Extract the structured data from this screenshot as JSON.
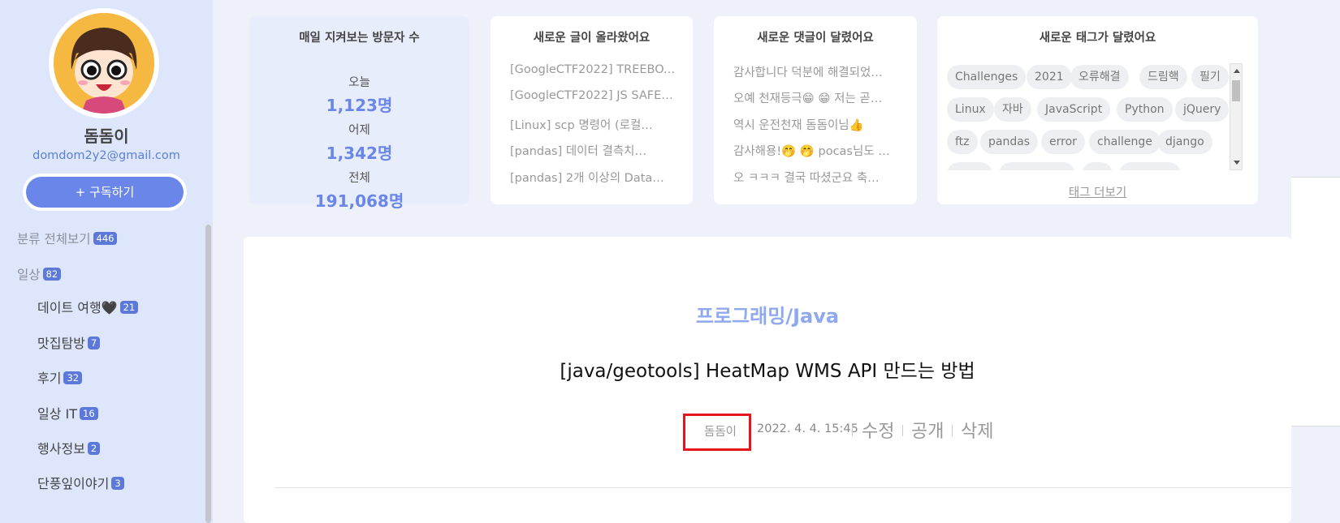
{
  "profile": {
    "name": "돔돔이",
    "email": "domdom2y2@gmail.com",
    "subscribe_label": "+ 구독하기"
  },
  "categories": [
    {
      "label": "분류 전체보기",
      "count": "446"
    },
    {
      "label": "일상",
      "count": "82"
    },
    {
      "label": "데이트 여행🖤",
      "count": "21"
    },
    {
      "label": "맛집탐방",
      "count": "7"
    },
    {
      "label": "후기",
      "count": "32"
    },
    {
      "label": "일상 IT",
      "count": "16"
    },
    {
      "label": "행사정보",
      "count": "2"
    },
    {
      "label": "단풍잎이야기",
      "count": "3"
    }
  ],
  "visitors": {
    "title": "매일 지켜보는 방문자 수",
    "today_label": "오늘",
    "today_value": "1,123명",
    "yesterday_label": "어제",
    "yesterday_value": "1,342명",
    "total_label": "전체",
    "total_value": "191,068명"
  },
  "new_posts": {
    "title": "새로운 글이 올라왔어요",
    "items": [
      "[GoogleCTF2022] TREEBOX…",
      "[GoogleCTF2022] JS SAFE…",
      "[Linux] scp 명령어 (로컬…",
      "[pandas] 데이터 결측치…",
      "[pandas] 2개 이상의 Data…"
    ]
  },
  "new_comments": {
    "title": "새로운 댓글이 달렸어요",
    "items": [
      "감사합니다 덕분에 해결되었…",
      "오예 천재등극😁 😁 저는 곧…",
      "역시 운전천재 돔돔이님👍",
      "감사해용!🤭 🤭 pocas님도 운…",
      "오 ㅋㅋㅋ 결국 따셨군요 축…"
    ]
  },
  "new_tags": {
    "title": "새로운 태그가 달렸어요",
    "tags": [
      "Challenges",
      "2021",
      "오류해결",
      "드림핵",
      "필기",
      "Linux",
      "자바",
      "JavaScript",
      "Python",
      "jQuery",
      "ftz",
      "pandas",
      "error",
      "challenge",
      "django"
    ],
    "more_label": "태그 더보기"
  },
  "post": {
    "category": "프로그래밍/Java",
    "title": "[java/geotools] HeatMap WMS API 만드는 방법",
    "author": "돔돔이",
    "date": "2022. 4. 4. 15:45",
    "edit_label": "수정",
    "visibility_label": "공개",
    "delete_label": "삭제"
  },
  "colors": {
    "accent": "#6a86e8",
    "sidebar_bg": "#dde6fb",
    "highlight_box": "#e3161e"
  }
}
